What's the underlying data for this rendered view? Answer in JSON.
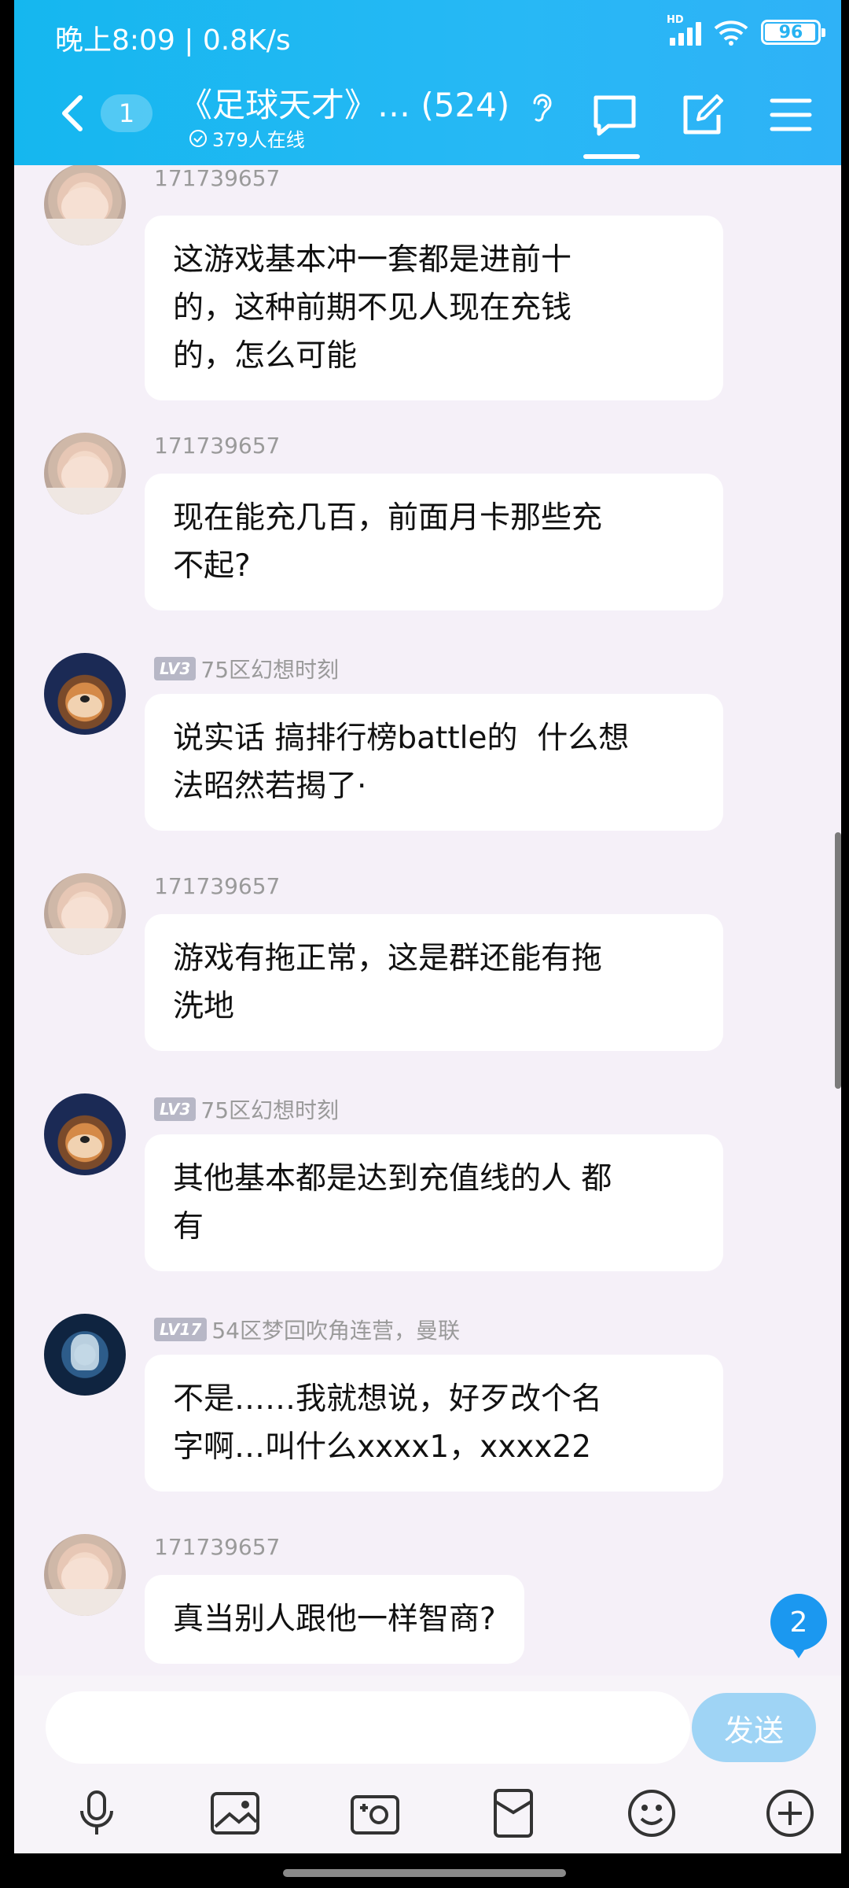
{
  "status_bar": {
    "time_speed": "晚上8:09 | 0.8K/s",
    "network_tag": "HD",
    "battery": "96"
  },
  "header": {
    "unread_count": "1",
    "group_title": "《足球天才》… (524)",
    "online_text": "379人在线"
  },
  "messages": [
    {
      "sender": "171739657",
      "level": "",
      "avatar": "baby-avatar",
      "text": "这游戏基本冲一套都是进前十\n的，这种前期不见人现在充钱\n的，怎么可能"
    },
    {
      "sender": "171739657",
      "level": "",
      "avatar": "baby-avatar",
      "text": "现在能充几百，前面月卡那些充\n不起?"
    },
    {
      "sender": "75区幻想时刻",
      "level": "LV3",
      "avatar": "bear-avatar",
      "text": "说实话 搞排行榜battle的  什么想\n法昭然若揭了·"
    },
    {
      "sender": "171739657",
      "level": "",
      "avatar": "baby-avatar",
      "text": "游戏有拖正常，这是群还能有拖\n洗地"
    },
    {
      "sender": "75区幻想时刻",
      "level": "LV3",
      "avatar": "bear-avatar",
      "text": "其他基本都是达到充值线的人 都\n有"
    },
    {
      "sender": "54区梦回吹角连营，曼联",
      "level": "LV17",
      "avatar": "knight-avatar",
      "text": "不是……我就想说，好歹改个名\n字啊…叫什么xxxx1，xxxx22"
    },
    {
      "sender": "171739657",
      "level": "",
      "avatar": "baby-avatar",
      "text": "真当别人跟他一样智商?"
    }
  ],
  "new_message_badge": "2",
  "input": {
    "placeholder": "",
    "send_label": "发送"
  },
  "toolbar": [
    "microphone-icon",
    "image-icon",
    "camera-icon",
    "red-packet-icon",
    "emoji-icon",
    "plus-icon"
  ],
  "colors": {
    "header": "#27b8f5",
    "background": "#f5f0f8",
    "send_button": "#9fd4f5",
    "level_badge": "#b7b7c6"
  }
}
